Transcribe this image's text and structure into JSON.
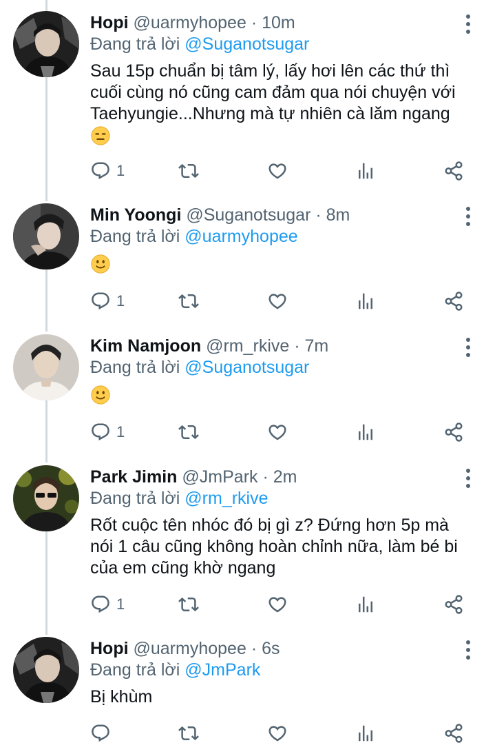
{
  "colors": {
    "link": "#1d9bf0",
    "muted": "#536471",
    "text": "#0f1419",
    "thread_line": "#cfd9de"
  },
  "tweets": [
    {
      "name": "Hopi",
      "handle": "@uarmyhopee",
      "sep": "·",
      "time": "10m",
      "reply_prefix": "Đang trả lời",
      "reply_to": "@Suganotsugar",
      "text_lines": [
        "Sau 15p chuẩn bị tâm lý, lấy hơi lên các thứ thì",
        "cuối cùng nó cũng cam đảm qua nói chuyện với",
        "Taehyungie...Nhưng mà tự nhiên cà lăm ngang"
      ],
      "emoji": "expressionless-face",
      "reply_count": "1"
    },
    {
      "name": "Min Yoongi",
      "handle": "@Suganotsugar",
      "sep": "·",
      "time": "8m",
      "reply_prefix": "Đang trả lời",
      "reply_to": "@uarmyhopee",
      "text_lines": [],
      "emoji": "slightly-smiling-face",
      "reply_count": "1"
    },
    {
      "name": "Kim Namjoon",
      "handle": "@rm_rkive",
      "sep": "·",
      "time": "7m",
      "reply_prefix": "Đang trả lời",
      "reply_to": "@Suganotsugar",
      "text_lines": [],
      "emoji": "slightly-smiling-face",
      "reply_count": "1"
    },
    {
      "name": "Park Jimin",
      "handle": "@JmPark",
      "sep": "·",
      "time": "2m",
      "reply_prefix": "Đang trả lời",
      "reply_to": "@rm_rkive",
      "text_lines": [
        "Rốt cuộc tên nhóc đó bị gì z? Đứng hơn 5p mà",
        "nói 1 câu cũng không hoàn chỉnh nữa, làm bé bi",
        "của em cũng khờ ngang"
      ],
      "emoji": null,
      "reply_count": "1"
    },
    {
      "name": "Hopi",
      "handle": "@uarmyhopee",
      "sep": "·",
      "time": "6s",
      "reply_prefix": "Đang trả lời",
      "reply_to": "@JmPark",
      "text_lines": [
        "Bị khùm"
      ],
      "emoji": null,
      "reply_count": ""
    }
  ]
}
